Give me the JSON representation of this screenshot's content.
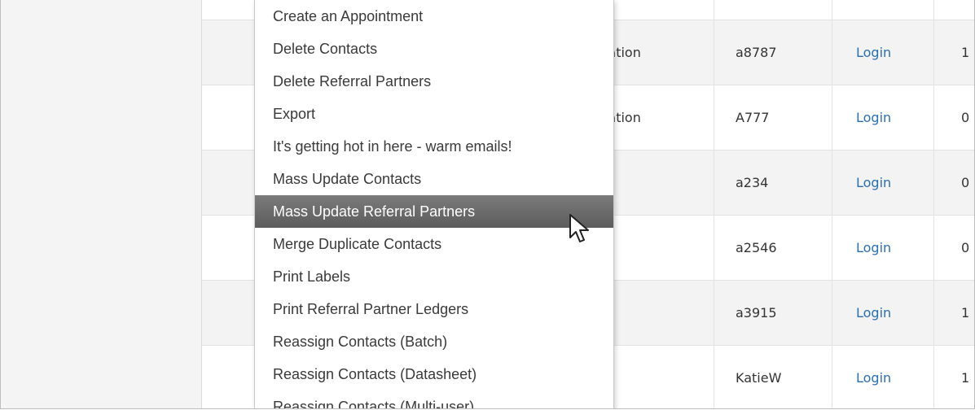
{
  "table": {
    "rows": [
      {
        "partial_org": "zation",
        "username": "a8787",
        "login": "Login",
        "partial_last": "1",
        "alt": true
      },
      {
        "partial_org": "zation",
        "username": "A777",
        "login": "Login",
        "partial_last": "0",
        "alt": false
      },
      {
        "partial_org": "",
        "username": "a234",
        "login": "Login",
        "partial_last": "0",
        "alt": true
      },
      {
        "partial_org": "",
        "username": "a2546",
        "login": "Login",
        "partial_last": "0",
        "alt": false
      },
      {
        "partial_org": "",
        "username": "a3915",
        "login": "Login",
        "partial_last": "1",
        "alt": true
      },
      {
        "partial_org": "",
        "username": "KatieW",
        "login": "Login",
        "partial_last": "1",
        "alt": false
      }
    ]
  },
  "context_menu": {
    "items": [
      "Create an Appointment",
      "Delete Contacts",
      "Delete Referral Partners",
      "Export",
      "It's getting hot in here - warm emails!",
      "Mass Update Contacts",
      "Mass Update Referral Partners",
      "Merge Duplicate Contacts",
      "Print Labels",
      "Print Referral Partner Ledgers",
      "Reassign Contacts (Batch)",
      "Reassign Contacts (Datasheet)",
      "Reassign Contacts (Multi-user)"
    ],
    "highlighted_index": 6
  },
  "colors": {
    "link": "#2a6fb2",
    "highlight": "#666666"
  }
}
